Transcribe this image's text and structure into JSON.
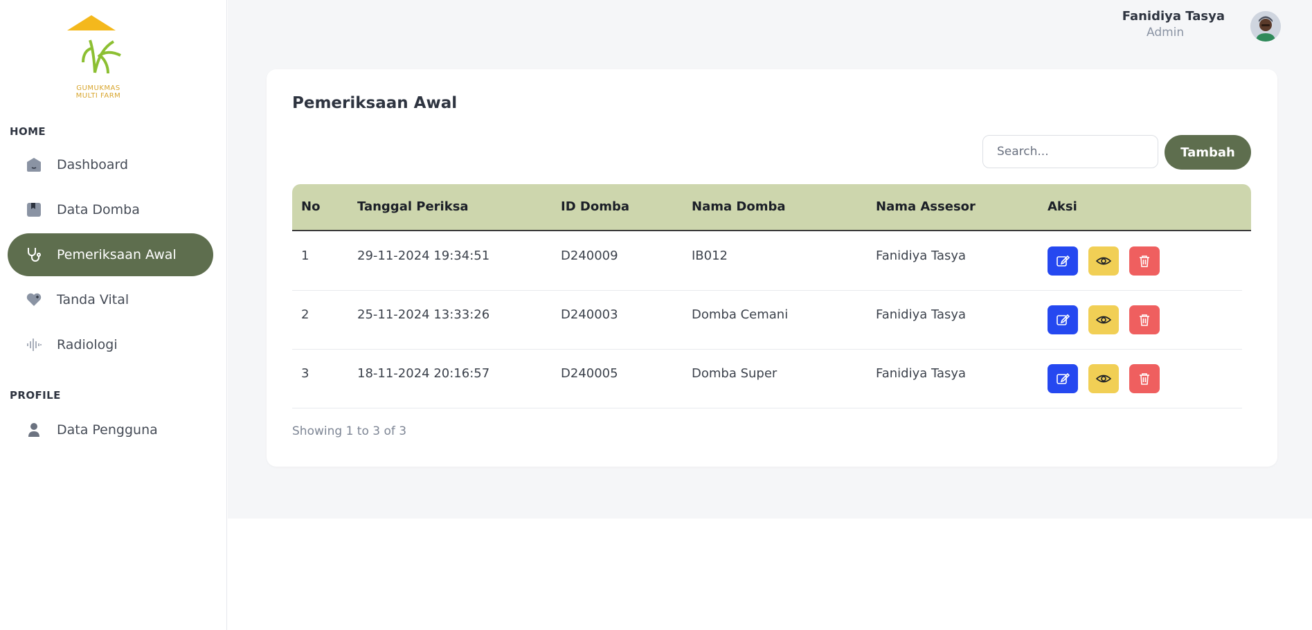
{
  "brand": {
    "logo_line1": "GUMUKMAS",
    "logo_line2": "MULTI FARM",
    "colors": {
      "gold": "#f4b81c",
      "green": "#8cbf32"
    }
  },
  "sidebar": {
    "section_home": "HOME",
    "section_profile": "PROFILE",
    "items": [
      {
        "label": "Dashboard",
        "icon": "home-icon",
        "active": false
      },
      {
        "label": "Data Domba",
        "icon": "bookmark-icon",
        "active": false
      },
      {
        "label": "Pemeriksaan Awal",
        "icon": "stethoscope-icon",
        "active": true
      },
      {
        "label": "Tanda Vital",
        "icon": "heart-icon",
        "active": false
      },
      {
        "label": "Radiologi",
        "icon": "waveform-icon",
        "active": false
      },
      {
        "label": "Data Pengguna",
        "icon": "user-icon",
        "active": false
      }
    ]
  },
  "user": {
    "name": "Fanidiya Tasya",
    "role": "Admin"
  },
  "page": {
    "title": "Pemeriksaan Awal",
    "search_placeholder": "Search...",
    "add_label": "Tambah",
    "footer": "Showing 1 to 3 of 3"
  },
  "table": {
    "headers": [
      "No",
      "Tanggal Periksa",
      "ID Domba",
      "Nama Domba",
      "Nama Assesor",
      "Aksi"
    ],
    "rows": [
      {
        "no": "1",
        "date": "29-11-2024 19:34:51",
        "id": "D240009",
        "name": "IB012",
        "assessor": "Fanidiya Tasya"
      },
      {
        "no": "2",
        "date": "25-11-2024 13:33:26",
        "id": "D240003",
        "name": "Domba Cemani",
        "assessor": "Fanidiya Tasya"
      },
      {
        "no": "3",
        "date": "18-11-2024 20:16:57",
        "id": "D240005",
        "name": "Domba Super",
        "assessor": "Fanidiya Tasya"
      }
    ]
  },
  "colors": {
    "accent": "#5e6e4e",
    "table_header": "#cdd6ad",
    "edit": "#2548f0",
    "view": "#f1cf55",
    "delete": "#ef5f5f"
  }
}
